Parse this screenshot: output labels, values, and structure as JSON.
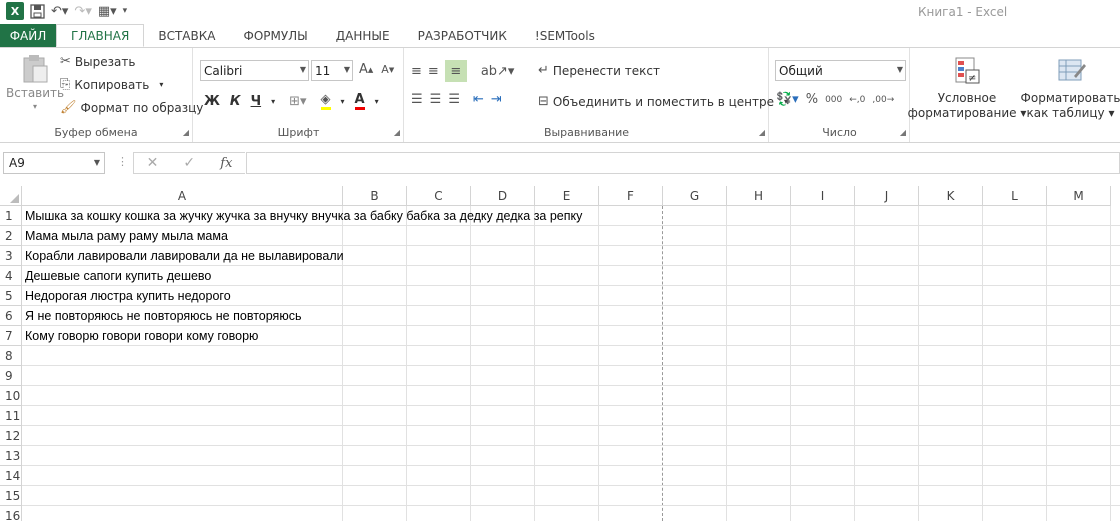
{
  "window": {
    "title": "Книга1 - Excel"
  },
  "tabs": [
    {
      "label": "ФАЙЛ"
    },
    {
      "label": "ГЛАВНАЯ"
    },
    {
      "label": "ВСТАВКА"
    },
    {
      "label": "ФОРМУЛЫ"
    },
    {
      "label": "ДАННЫЕ"
    },
    {
      "label": "РАЗРАБОТЧИК"
    },
    {
      "label": "!SEMTools"
    }
  ],
  "ribbon": {
    "clipboard": {
      "label": "Буфер обмена",
      "paste": "Вставить",
      "cut": "Вырезать",
      "copy": "Копировать",
      "format_painter": "Формат по образцу"
    },
    "font": {
      "label": "Шрифт",
      "font_name": "Calibri",
      "font_size": "11",
      "bold": "Ж",
      "italic": "К",
      "underline": "Ч"
    },
    "alignment": {
      "label": "Выравнивание",
      "wrap_text": "Перенести текст",
      "merge_center": "Объединить и поместить в центре"
    },
    "number": {
      "label": "Число",
      "format": "Общий",
      "percent": "%",
      "thousands": "000"
    },
    "styles": {
      "conditional": "Условное форматирование",
      "conditional_l1": "Условное",
      "conditional_l2": "форматирование",
      "format_table_l1": "Форматировать",
      "format_table_l2": "как таблицу"
    }
  },
  "formula_bar": {
    "name_box": "A9",
    "fx": "fx",
    "value": ""
  },
  "grid": {
    "columns": [
      "A",
      "B",
      "C",
      "D",
      "E",
      "F",
      "G",
      "H",
      "I",
      "J",
      "K",
      "L",
      "M"
    ],
    "rows": [
      "1",
      "2",
      "3",
      "4",
      "5",
      "6",
      "7",
      "8",
      "9",
      "10",
      "11",
      "12",
      "13",
      "14",
      "15",
      "16"
    ],
    "cells_a": [
      "Мышка за кошку кошка за жучку жучка за внучку внучка за бабку бабка за дедку дедка за репку",
      "Мама мыла раму раму мыла мама",
      "Корабли лавировали лавировали да не вылавировали",
      "Дешевые сапоги купить дешево",
      "Недорогая люстра купить недорого",
      "Я не повторяюсь не повторяюсь не повторяюсь",
      "Кому говорю говори говори кому говорю"
    ]
  }
}
